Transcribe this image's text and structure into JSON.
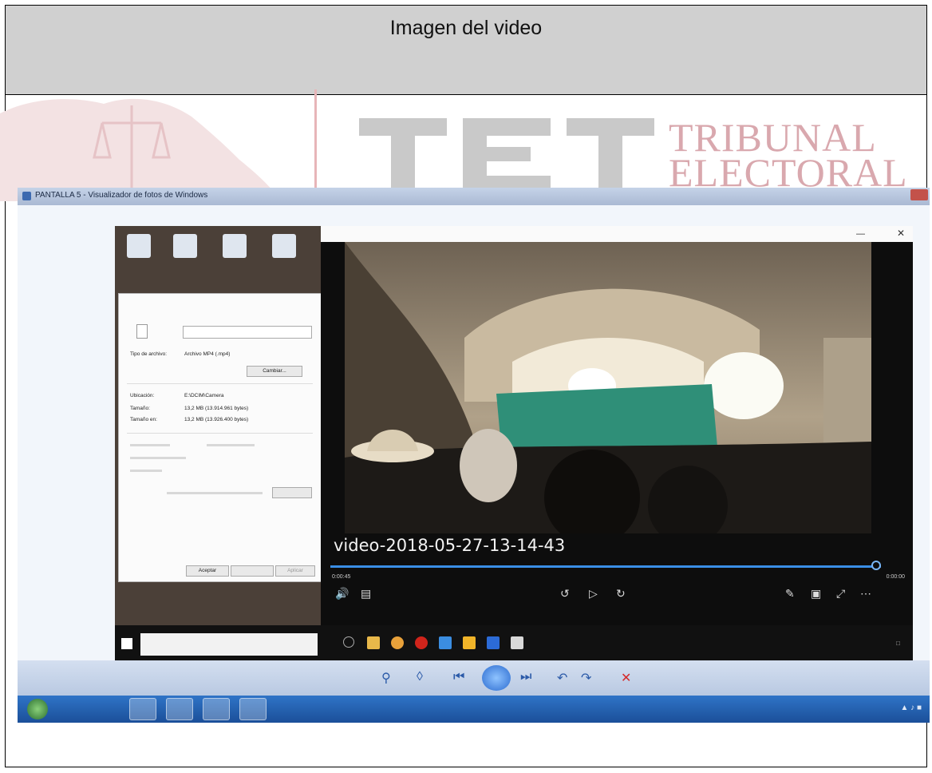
{
  "header": {
    "title": "Imagen del video"
  },
  "watermark": {
    "line1": "TRIBUNAL",
    "line2": "ELECTORAL",
    "color": "#d9a8ae"
  },
  "viewer": {
    "title": "PANTALLA 5 - Visualizador de fotos de Windows"
  },
  "properties": {
    "type_label": "Tipo de archivo:",
    "type_value": "Archivo MP4 (.mp4)",
    "change_button": "Cambiar...",
    "location_label": "Ubicación:",
    "location_value": "E:\\DCIM\\Camera",
    "size_label": "Tamaño:",
    "size_value": "13,2 MB (13.914.961 bytes)",
    "disk_size_label": "Tamaño en:",
    "disk_size_value": "13,2 MB (13.926.400 bytes)",
    "accept_button": "Aceptar",
    "cancel_button": "",
    "apply_button": "Aplicar"
  },
  "player": {
    "caption": "video-2018-05-27-13-14-43",
    "time_elapsed": "0:00:45",
    "time_total": "0:00:00",
    "progress": 1.0
  },
  "colors": {
    "seek": "#3a8ee6",
    "teal_banner": "#2f8f78",
    "viewer_chrome": "#cfd9e8",
    "w7_taskbar": "#2f74c7"
  },
  "icons": {
    "viewer_toolbar": [
      "zoom-icon",
      "fit-icon",
      "previous-icon",
      "slideshow-icon",
      "next-icon",
      "rotate-left-icon",
      "rotate-right-icon",
      "delete-icon"
    ],
    "player_controls": [
      "volume-icon",
      "subtitles-icon",
      "rewind-icon",
      "play-icon",
      "forward-icon",
      "pen-icon",
      "miniview-icon",
      "fullscreen-icon",
      "more-icon"
    ]
  }
}
